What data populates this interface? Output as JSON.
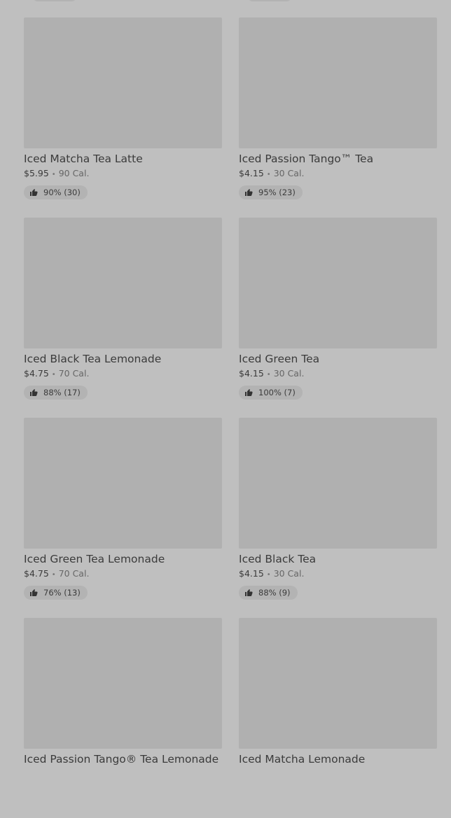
{
  "products": [
    {
      "name": "Iced Matcha Tea Latte",
      "price": "$5.95",
      "calories": "90 Cal.",
      "rating": "90% (30)"
    },
    {
      "name": "Iced Passion Tango™ Tea",
      "price": "$4.15",
      "calories": "30 Cal.",
      "rating": "95% (23)"
    },
    {
      "name": "Iced Black Tea Lemonade",
      "price": "$4.75",
      "calories": "70 Cal.",
      "rating": "88% (17)"
    },
    {
      "name": "Iced Green Tea",
      "price": "$4.15",
      "calories": "30 Cal.",
      "rating": "100% (7)"
    },
    {
      "name": "Iced Green Tea Lemonade",
      "price": "$4.75",
      "calories": "70 Cal.",
      "rating": "76% (13)"
    },
    {
      "name": "Iced Black Tea",
      "price": "$4.15",
      "calories": "30 Cal.",
      "rating": "88% (9)"
    },
    {
      "name": "Iced Passion Tango® Tea Lemonade",
      "price": "",
      "calories": "",
      "rating": ""
    },
    {
      "name": "Iced Matcha Lemonade",
      "price": "",
      "calories": "",
      "rating": ""
    }
  ],
  "separator": "•",
  "icons": {
    "rating": "thumbs-up-icon"
  },
  "colors": {
    "background": "#bfbfbf",
    "placeholder": "#b0b0b0",
    "text": "#3b3b3b"
  }
}
